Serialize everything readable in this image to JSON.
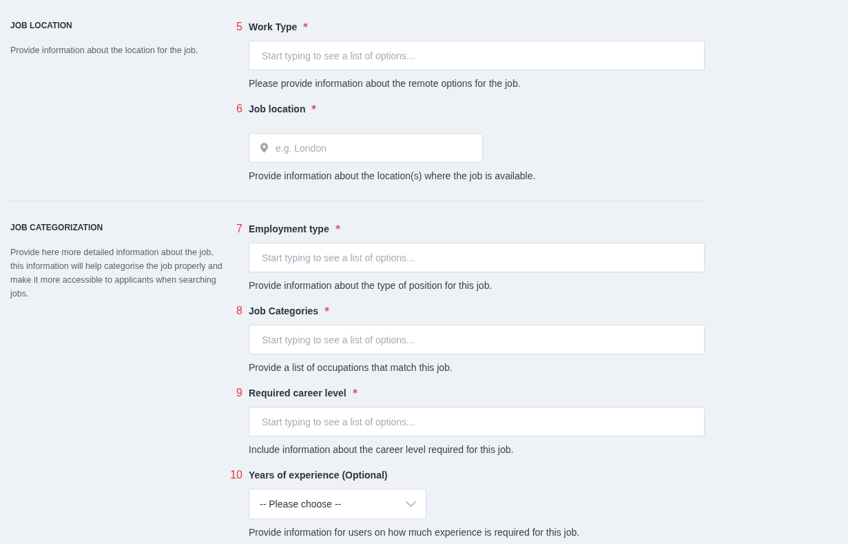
{
  "sections": [
    {
      "title": "JOB LOCATION",
      "description": "Provide information about the location for the job.",
      "fields": [
        {
          "number": "5",
          "label": "Work Type",
          "required": true,
          "kind": "text",
          "placeholder": "Start typing to see a list of options...",
          "help": "Please provide information about the remote options for the job."
        },
        {
          "number": "6",
          "label": "Job location",
          "required": true,
          "kind": "location",
          "placeholder": "e.g. London",
          "help": "Provide information about the location(s) where the job is available."
        }
      ]
    },
    {
      "title": "JOB CATEGORIZATION",
      "description": "Provide here more detailed information about the job, this information will help categorise the job properly and make it more accessible to applicants when searching jobs.",
      "fields": [
        {
          "number": "7",
          "label": "Employment type",
          "required": true,
          "kind": "text",
          "placeholder": "Start typing to see a list of options...",
          "help": "Provide information about the type of position for this job."
        },
        {
          "number": "8",
          "label": "Job Categories",
          "required": true,
          "kind": "text",
          "placeholder": "Start typing to see a list of options...",
          "help": "Provide a list of occupations that match this job."
        },
        {
          "number": "9",
          "label": "Required career level",
          "required": true,
          "kind": "text",
          "placeholder": "Start typing to see a list of options...",
          "help": "Include information about the career level required for this job."
        },
        {
          "number": "10",
          "label": "Years of experience (Optional)",
          "required": false,
          "kind": "select",
          "value": "-- Please choose --",
          "help": "Provide information for users on how much experience is required for this job."
        }
      ]
    }
  ]
}
